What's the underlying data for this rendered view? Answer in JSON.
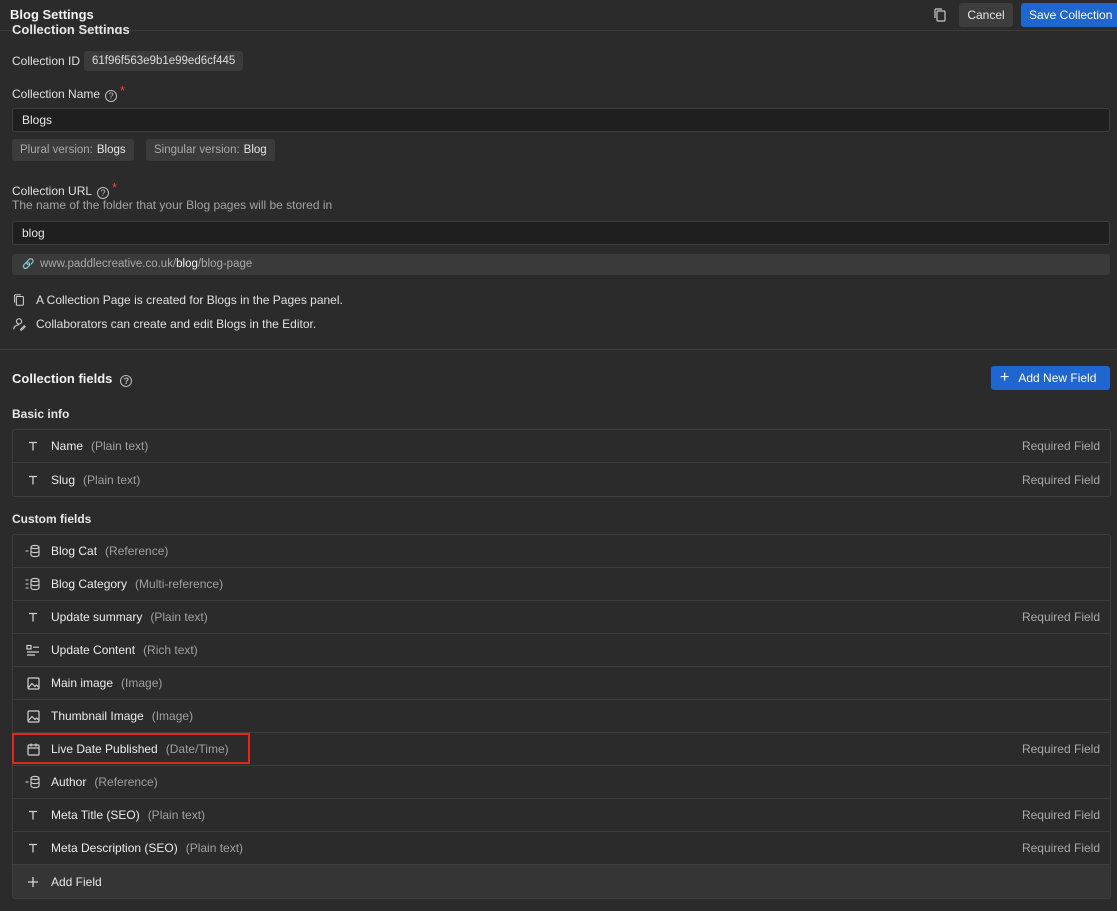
{
  "header": {
    "title": "Blog Settings",
    "copy_icon": "copy-icon",
    "cancel_label": "Cancel",
    "save_label": "Save Collection"
  },
  "settings": {
    "section_title": "Collection Settings",
    "id_label": "Collection ID",
    "id_value": "61f96f563e9b1e99ed6cf445",
    "name_label": "Collection Name",
    "name_value": "Blogs",
    "plural_label": "Plural version:",
    "plural_value": "Blogs",
    "singular_label": "Singular version:",
    "singular_value": "Blog",
    "url_label": "Collection URL",
    "url_description": "The name of the folder that your Blog pages will be stored in",
    "url_value": "blog",
    "url_preview_prefix": "www.paddlecreative.co.uk/",
    "url_preview_slug": "blog",
    "url_preview_suffix": "/blog-page",
    "info_page": "A Collection Page is created for Blogs in the Pages panel.",
    "info_collab": "Collaborators can create and edit Blogs in the Editor.",
    "required_mark": "*",
    "help_mark": "?"
  },
  "fields": {
    "title": "Collection fields",
    "add_new_label": "Add New Field",
    "basic_title": "Basic info",
    "basic": [
      {
        "name": "Name",
        "type": "(Plain text)",
        "required": "Required Field",
        "icon": "text-icon"
      },
      {
        "name": "Slug",
        "type": "(Plain text)",
        "required": "Required Field",
        "icon": "text-icon"
      }
    ],
    "custom_title": "Custom fields",
    "custom": [
      {
        "name": "Blog Cat",
        "type": "(Reference)",
        "required": "",
        "icon": "reference-icon"
      },
      {
        "name": "Blog Category",
        "type": "(Multi-reference)",
        "required": "",
        "icon": "multi-reference-icon"
      },
      {
        "name": "Update summary",
        "type": "(Plain text)",
        "required": "Required Field",
        "icon": "text-icon"
      },
      {
        "name": "Update Content",
        "type": "(Rich text)",
        "required": "",
        "icon": "rich-text-icon"
      },
      {
        "name": "Main image",
        "type": "(Image)",
        "required": "",
        "icon": "image-icon"
      },
      {
        "name": "Thumbnail Image",
        "type": "(Image)",
        "required": "",
        "icon": "image-icon"
      },
      {
        "name": "Live Date Published",
        "type": "(Date/Time)",
        "required": "Required Field",
        "icon": "calendar-icon"
      },
      {
        "name": "Author",
        "type": "(Reference)",
        "required": "",
        "icon": "reference-icon"
      },
      {
        "name": "Meta Title (SEO)",
        "type": "(Plain text)",
        "required": "Required Field",
        "icon": "text-icon"
      },
      {
        "name": "Meta Description (SEO)",
        "type": "(Plain text)",
        "required": "Required Field",
        "icon": "text-icon"
      }
    ],
    "add_field_label": "Add Field"
  },
  "colors": {
    "accent": "#1f66d0",
    "highlight": "#e0281e",
    "required_star": "#e5483a"
  }
}
